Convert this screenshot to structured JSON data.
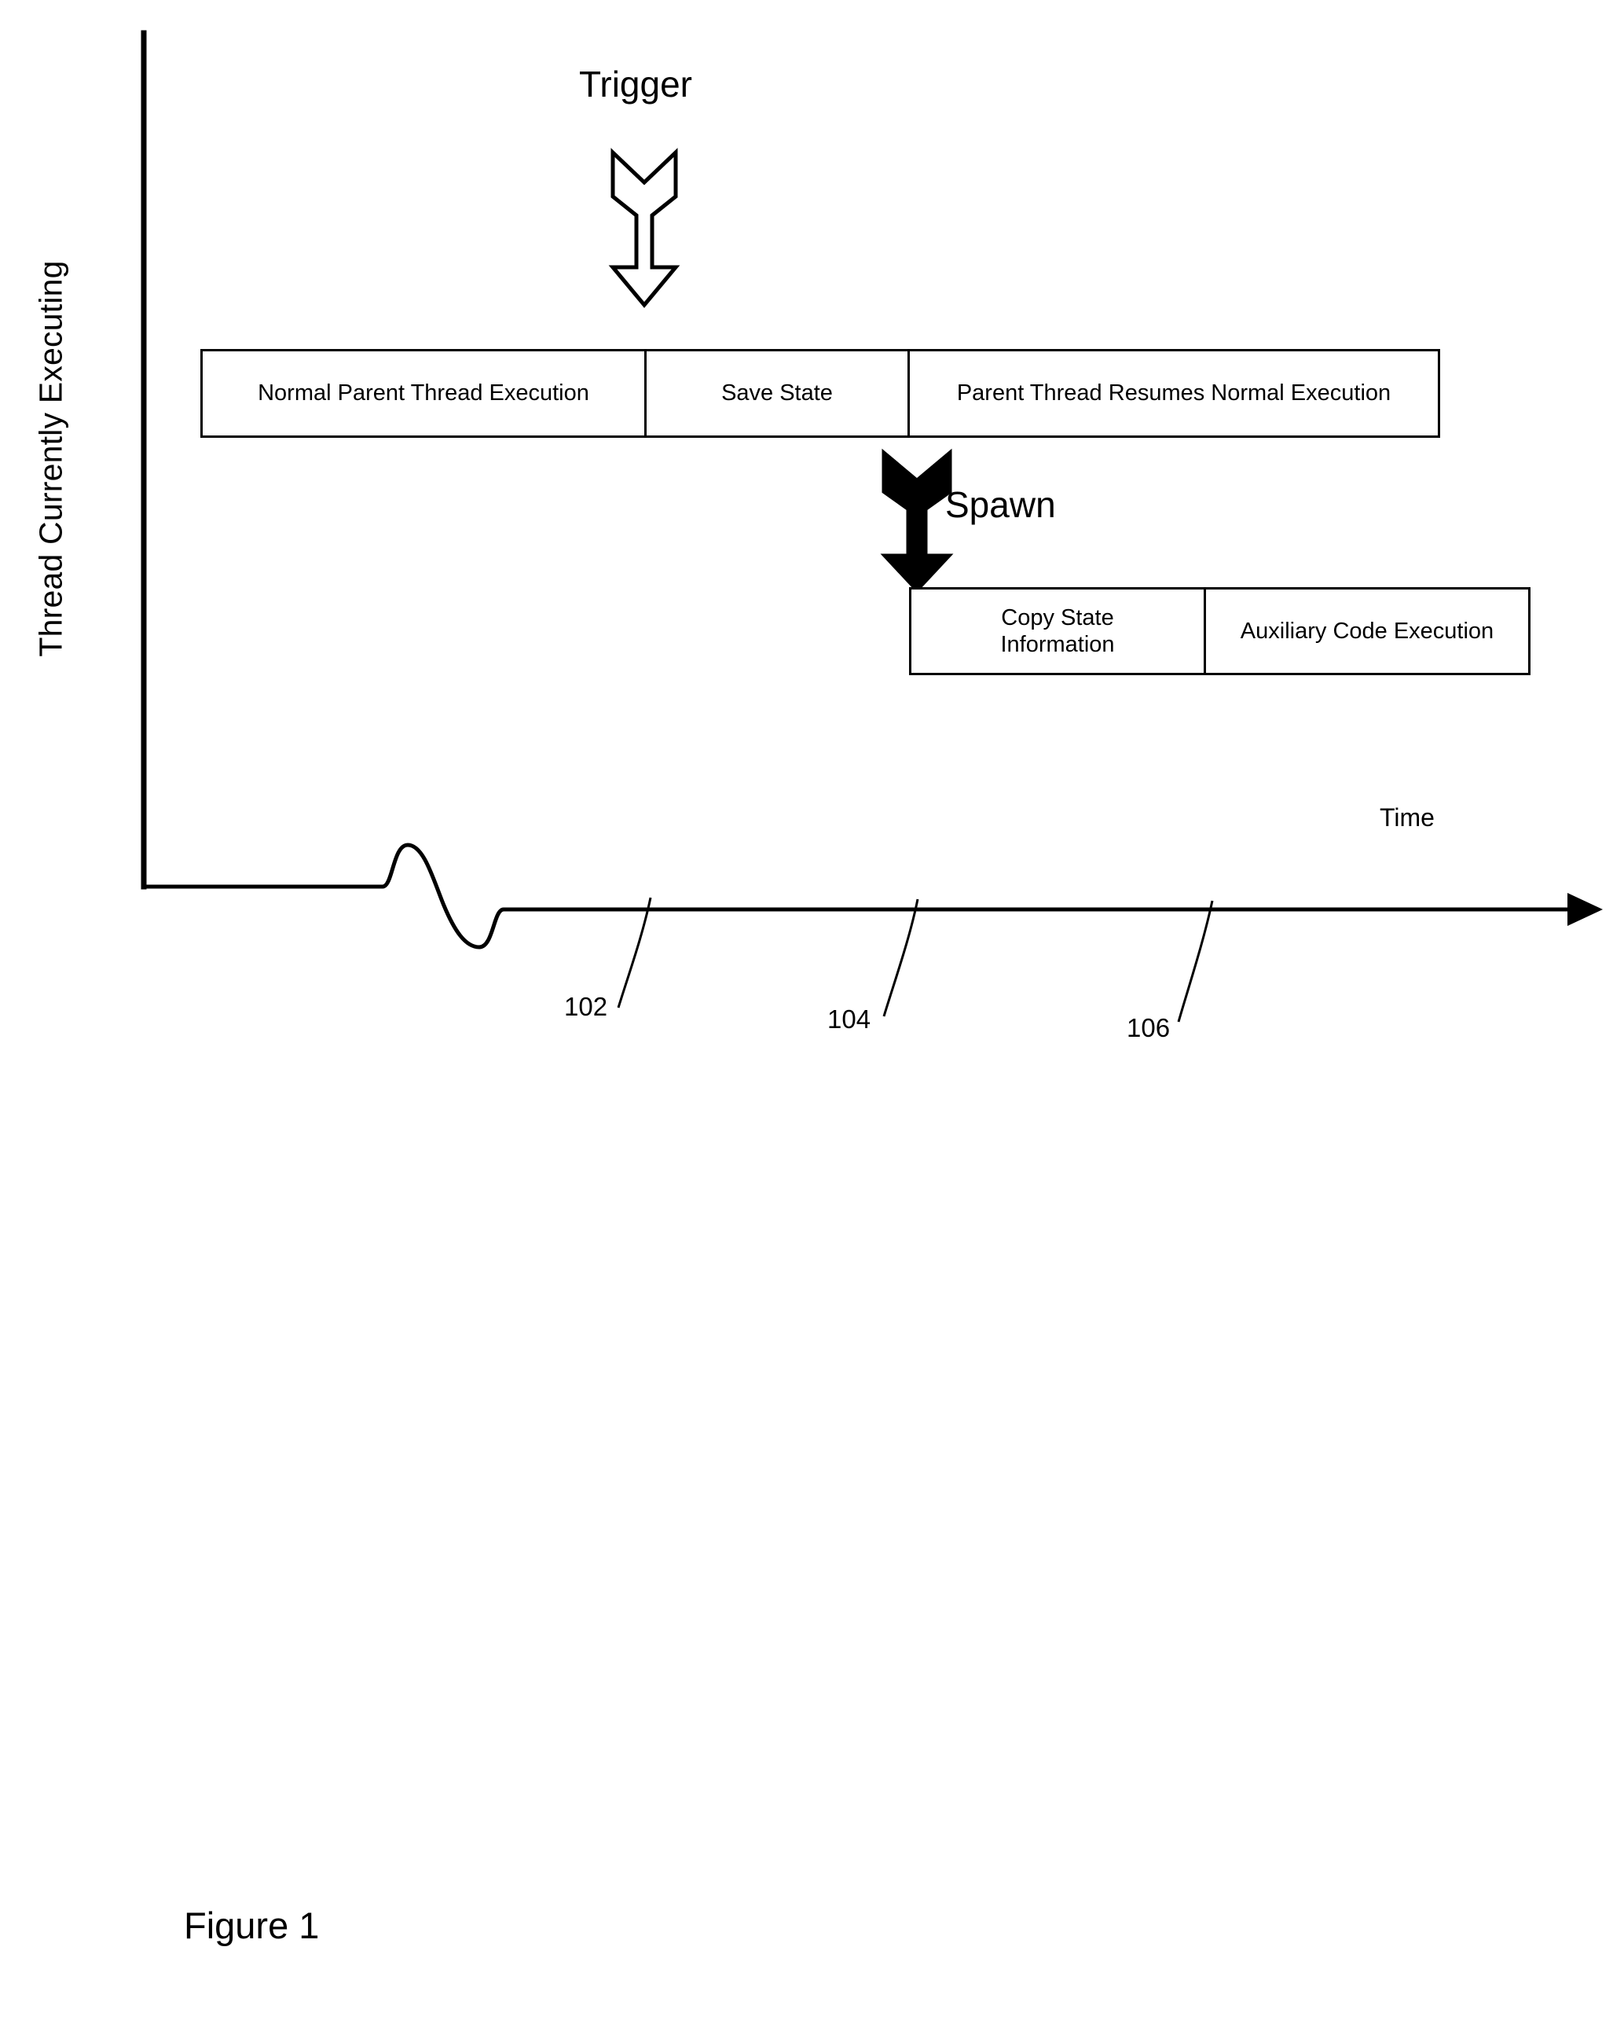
{
  "figure": {
    "caption": "Figure 1",
    "y_axis_label": "Thread Currently Executing",
    "x_axis_label": "Time"
  },
  "arrows": [
    {
      "name": "trigger",
      "label": "Trigger",
      "style": "hollow",
      "direction": "down"
    },
    {
      "name": "spawn",
      "label": "Spawn",
      "style": "filled",
      "direction": "down"
    }
  ],
  "parent_thread": {
    "name": "parent-thread-timeline",
    "segments": [
      {
        "label": "Normal Parent Thread Execution"
      },
      {
        "label": "Save State"
      },
      {
        "label": "Parent Thread Resumes Normal Execution"
      }
    ]
  },
  "child_thread": {
    "name": "child-thread-timeline",
    "segments": [
      {
        "label": "Copy State\nInformation"
      },
      {
        "label": "Auxiliary Code Execution"
      }
    ]
  },
  "reference_numerals": [
    {
      "id": "102",
      "label": "102"
    },
    {
      "id": "104",
      "label": "104"
    },
    {
      "id": "106",
      "label": "106"
    }
  ],
  "colors": {
    "stroke": "#000000",
    "fill": "#ffffff",
    "background": "#ffffff"
  }
}
